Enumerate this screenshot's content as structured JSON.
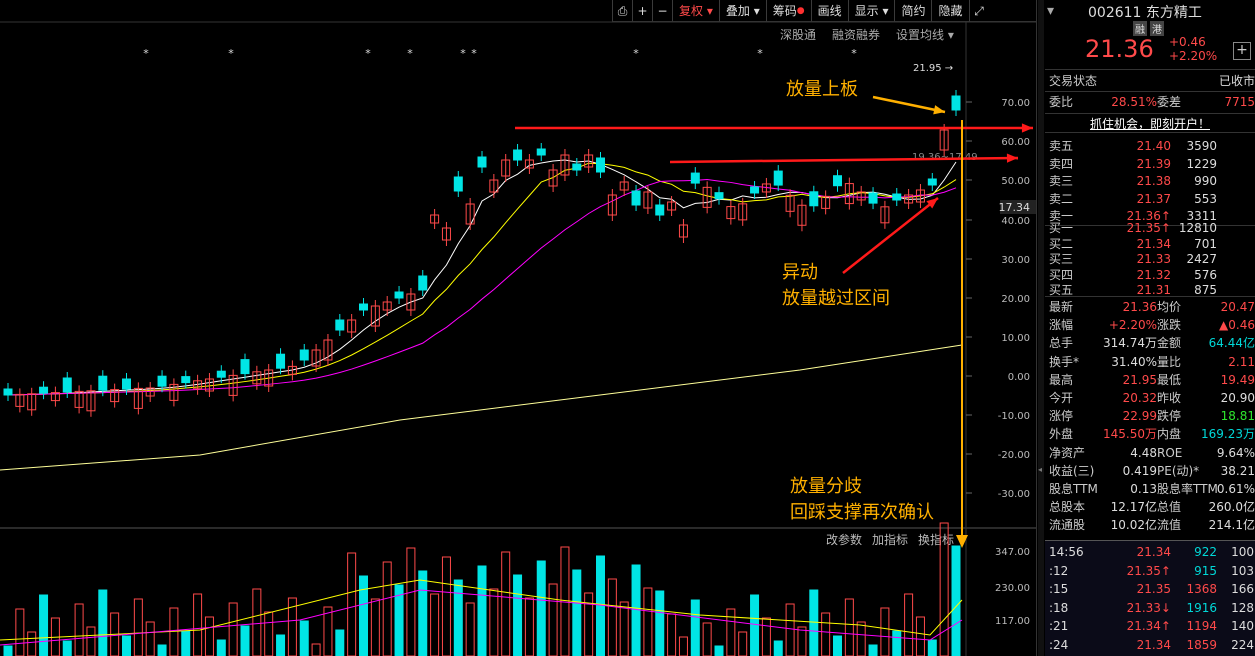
{
  "toolbar": {
    "items": [
      "复权",
      "叠加",
      "筹码",
      "画线",
      "显示",
      "简约",
      "隐藏"
    ],
    "links": [
      "深股通",
      "融资融券",
      "设置均线"
    ]
  },
  "chart": {
    "high_label": "21.95",
    "range_label": "19.36~17.49",
    "current_price_tag": "17.34",
    "y_ticks": [
      "70.00",
      "60.00",
      "50.00",
      "40.00",
      "30.00",
      "20.00",
      "10.00",
      "0.00",
      "-10.00",
      "-20.00",
      "-30.00"
    ],
    "vol_ticks": [
      "347.00",
      "230.00",
      "117.00"
    ],
    "vol_menu": [
      "改参数",
      "加指标",
      "换指标"
    ]
  },
  "annotations": {
    "a1": "放量上板",
    "a2_line1": "异动",
    "a2_line2": "放量越过区间",
    "a3_line1": "放量分歧",
    "a3_line2": "回踩支撑再次确认"
  },
  "stock": {
    "code": "002611",
    "name": "东方精工",
    "badges": [
      "融",
      "港"
    ],
    "price": "21.36",
    "change": "+0.46",
    "change_pct": "+2.20%",
    "status_label": "交易状态",
    "status_value": "已收市",
    "weibi_label": "委比",
    "weibi_value": "28.51%",
    "weicha_label": "委差",
    "weicha_value": "7715",
    "promo": "抓住机会，即刻开户！"
  },
  "order_book": {
    "asks": [
      {
        "label": "卖五",
        "price": "21.40",
        "vol": "3590"
      },
      {
        "label": "卖四",
        "price": "21.39",
        "vol": "1229"
      },
      {
        "label": "卖三",
        "price": "21.38",
        "vol": "990"
      },
      {
        "label": "卖二",
        "price": "21.37",
        "vol": "553"
      },
      {
        "label": "卖一",
        "price": "21.36↑",
        "vol": "3311"
      }
    ],
    "bids": [
      {
        "label": "买一",
        "price": "21.35↑",
        "vol": "12810"
      },
      {
        "label": "买二",
        "price": "21.34",
        "vol": "701"
      },
      {
        "label": "买三",
        "price": "21.33",
        "vol": "2427"
      },
      {
        "label": "买四",
        "price": "21.32",
        "vol": "576"
      },
      {
        "label": "买五",
        "price": "21.31",
        "vol": "875"
      }
    ]
  },
  "stats": [
    {
      "l1": "最新",
      "v1": "21.36",
      "c1": "red",
      "l2": "均价",
      "v2": "20.47",
      "c2": "red"
    },
    {
      "l1": "涨幅",
      "v1": "+2.20%",
      "c1": "red",
      "l2": "涨跌",
      "v2": "▲0.46",
      "c2": "red"
    },
    {
      "l1": "总手",
      "v1": "314.74万",
      "c1": "white",
      "l2": "金额",
      "v2": "64.44亿",
      "c2": "cyan"
    },
    {
      "l1": "换手*",
      "v1": "31.40%",
      "c1": "white",
      "l2": "量比",
      "v2": "2.11",
      "c2": "red"
    },
    {
      "l1": "最高",
      "v1": "21.95",
      "c1": "red",
      "l2": "最低",
      "v2": "19.49",
      "c2": "red"
    },
    {
      "l1": "今开",
      "v1": "20.32",
      "c1": "red",
      "l2": "昨收",
      "v2": "20.90",
      "c2": "white"
    },
    {
      "l1": "涨停",
      "v1": "22.99",
      "c1": "red",
      "l2": "跌停",
      "v2": "18.81",
      "c2": "green"
    },
    {
      "l1": "外盘",
      "v1": "145.50万",
      "c1": "red",
      "l2": "内盘",
      "v2": "169.23万",
      "c2": "cyan"
    },
    {
      "l1": "净资产",
      "v1": "4.48",
      "c1": "white",
      "l2": "ROE",
      "v2": "9.64%",
      "c2": "white"
    },
    {
      "l1": "收益(三)",
      "v1": "0.419",
      "c1": "white",
      "l2": "PE(动)*",
      "v2": "38.21",
      "c2": "white"
    },
    {
      "l1": "股息TTM",
      "v1": "0.13",
      "c1": "white",
      "l2": "股息率TTM",
      "v2": "0.61%",
      "c2": "white"
    },
    {
      "l1": "总股本",
      "v1": "12.17亿",
      "c1": "white",
      "l2": "总值",
      "v2": "260.0亿",
      "c2": "white"
    },
    {
      "l1": "流通股",
      "v1": "10.02亿",
      "c1": "white",
      "l2": "流值",
      "v2": "214.1亿",
      "c2": "white"
    }
  ],
  "ticks": [
    {
      "time": "14:56",
      "price": "21.34",
      "pc": "red",
      "vol": "922",
      "vc": "cyan",
      "n": "100"
    },
    {
      "time": ":12",
      "price": "21.35↑",
      "pc": "red",
      "vol": "915",
      "vc": "cyan",
      "n": "103"
    },
    {
      "time": ":15",
      "price": "21.35",
      "pc": "red",
      "vol": "1368",
      "vc": "red",
      "n": "166"
    },
    {
      "time": ":18",
      "price": "21.33↓",
      "pc": "red",
      "vol": "1916",
      "vc": "cyan",
      "n": "128"
    },
    {
      "time": ":21",
      "price": "21.34↑",
      "pc": "red",
      "vol": "1194",
      "vc": "red",
      "n": "140"
    },
    {
      "time": ":24",
      "price": "21.34",
      "pc": "red",
      "vol": "1859",
      "vc": "red",
      "n": "224"
    }
  ],
  "colors": {
    "up": "#ff4a4a",
    "down": "#00e5e5",
    "ma5": "#ffffff",
    "ma10": "#ffff00",
    "ma20": "#ff00ff",
    "ma250": "#ffff99",
    "annot": "#ffb000",
    "arrow": "#ff1a1a"
  }
}
